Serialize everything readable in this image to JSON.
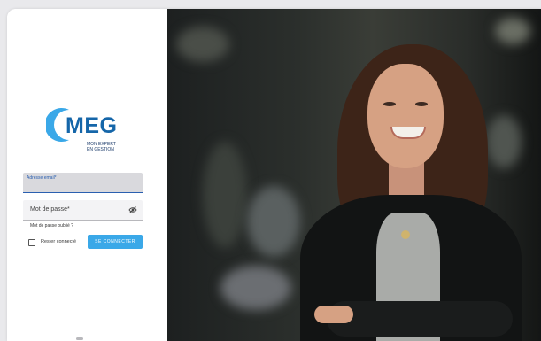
{
  "brand": {
    "logo_text": "MEG",
    "tagline_line1": "MON EXPERT",
    "tagline_line2": "EN GESTION",
    "logo_color": "#1566a9"
  },
  "login": {
    "email_label": "Adresse email*",
    "email_value": "",
    "password_placeholder": "Mot de passe*",
    "forgot_password": "Mot de passe oublié ?",
    "remember_me": "Rester connecté",
    "submit_label": "SE CONNECTER",
    "accent_color": "#3aa8e8"
  },
  "icons": {
    "password_toggle": "eye-slash-icon",
    "remember_checkbox": "checkbox-unchecked"
  }
}
